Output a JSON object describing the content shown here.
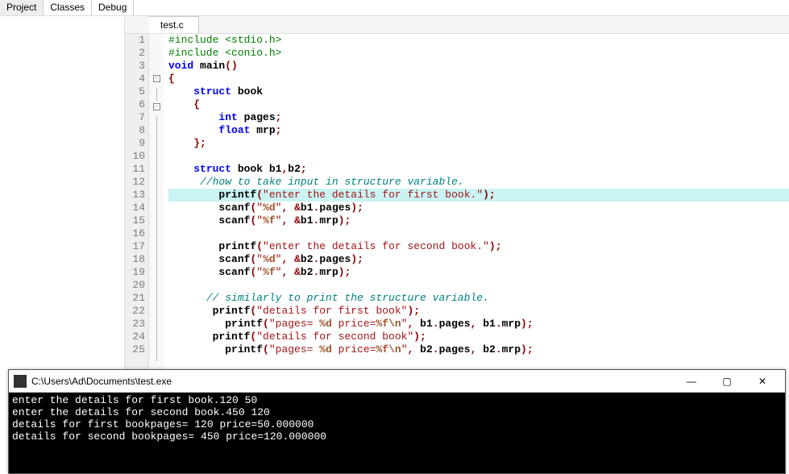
{
  "top_tabs": {
    "project": "Project",
    "classes": "Classes",
    "debug": "Debug"
  },
  "file_tab": "test.c",
  "code_lines": [
    {
      "n": 1,
      "fold": "",
      "hl": false,
      "html": "<span class='pre'>#include &lt;stdio.h&gt;</span>"
    },
    {
      "n": 2,
      "fold": "",
      "hl": false,
      "html": "<span class='pre'>#include &lt;conio.h&gt;</span>"
    },
    {
      "n": 3,
      "fold": "",
      "hl": false,
      "html": "<span class='kw'>void</span> <span class='blk'>main</span><span class='brace'>()</span>"
    },
    {
      "n": 4,
      "fold": "box",
      "hl": false,
      "html": "<span class='brace'>{</span>"
    },
    {
      "n": 5,
      "fold": "line",
      "hl": false,
      "html": "    <span class='kw'>struct</span> <span class='blk'>book</span>"
    },
    {
      "n": 6,
      "fold": "box",
      "hl": false,
      "html": "    <span class='brace'>{</span>"
    },
    {
      "n": 7,
      "fold": "line",
      "hl": false,
      "html": "        <span class='kw'>int</span> <span class='blk'>pages</span><span class='brace'>;</span>"
    },
    {
      "n": 8,
      "fold": "line",
      "hl": false,
      "html": "        <span class='kw'>float</span> <span class='blk'>mrp</span><span class='brace'>;</span>"
    },
    {
      "n": 9,
      "fold": "end",
      "hl": false,
      "html": "    <span class='brace'>};</span>"
    },
    {
      "n": 10,
      "fold": "line",
      "hl": false,
      "html": ""
    },
    {
      "n": 11,
      "fold": "line",
      "hl": false,
      "html": "    <span class='kw'>struct</span> <span class='blk'>book b1</span><span class='brace'>,</span><span class='blk'>b2</span><span class='brace'>;</span>"
    },
    {
      "n": 12,
      "fold": "line",
      "hl": false,
      "html": "     <span class='cmt'>//how to take input in structure variable.</span>"
    },
    {
      "n": 13,
      "fold": "line",
      "hl": true,
      "html": "        <span class='blk'>printf</span><span class='brace'>(</span><span class='str'>\"enter the details for first book.\"</span><span class='brace'>);</span>"
    },
    {
      "n": 14,
      "fold": "line",
      "hl": false,
      "html": "        <span class='blk'>scanf</span><span class='brace'>(</span><span class='str'>\"</span><span class='brown'>%d</span><span class='str'>\"</span><span class='brace'>,</span> <span class='brace'>&amp;</span><span class='blk'>b1</span><span class='brace'>.</span><span class='blk'>pages</span><span class='brace'>);</span>"
    },
    {
      "n": 15,
      "fold": "line",
      "hl": false,
      "html": "        <span class='blk'>scanf</span><span class='brace'>(</span><span class='str'>\"</span><span class='brown'>%f</span><span class='str'>\"</span><span class='brace'>,</span> <span class='brace'>&amp;</span><span class='blk'>b1</span><span class='brace'>.</span><span class='blk'>mrp</span><span class='brace'>);</span>"
    },
    {
      "n": 16,
      "fold": "line",
      "hl": false,
      "html": ""
    },
    {
      "n": 17,
      "fold": "line",
      "hl": false,
      "html": "        <span class='blk'>printf</span><span class='brace'>(</span><span class='str'>\"enter the details for second book.\"</span><span class='brace'>);</span>"
    },
    {
      "n": 18,
      "fold": "line",
      "hl": false,
      "html": "        <span class='blk'>scanf</span><span class='brace'>(</span><span class='str'>\"</span><span class='brown'>%d</span><span class='str'>\"</span><span class='brace'>,</span> <span class='brace'>&amp;</span><span class='blk'>b2</span><span class='brace'>.</span><span class='blk'>pages</span><span class='brace'>);</span>"
    },
    {
      "n": 19,
      "fold": "line",
      "hl": false,
      "html": "        <span class='blk'>scanf</span><span class='brace'>(</span><span class='str'>\"</span><span class='brown'>%f</span><span class='str'>\"</span><span class='brace'>,</span> <span class='brace'>&amp;</span><span class='blk'>b2</span><span class='brace'>.</span><span class='blk'>mrp</span><span class='brace'>);</span>"
    },
    {
      "n": 20,
      "fold": "line",
      "hl": false,
      "html": ""
    },
    {
      "n": 21,
      "fold": "line",
      "hl": false,
      "html": "      <span class='cmt'>// similarly to print the structure variable.</span>"
    },
    {
      "n": 22,
      "fold": "line",
      "hl": false,
      "html": "       <span class='blk'>printf</span><span class='brace'>(</span><span class='str'>\"details for first book\"</span><span class='brace'>);</span>"
    },
    {
      "n": 23,
      "fold": "line",
      "hl": false,
      "html": "         <span class='blk'>printf</span><span class='brace'>(</span><span class='str'>\"pages= </span><span class='brown'>%d</span><span class='str'> price=</span><span class='brown'>%f\\n</span><span class='str'>\"</span><span class='brace'>,</span> <span class='blk'>b1</span><span class='brace'>.</span><span class='blk'>pages</span><span class='brace'>,</span> <span class='blk'>b1</span><span class='brace'>.</span><span class='blk'>mrp</span><span class='brace'>);</span>"
    },
    {
      "n": 24,
      "fold": "line",
      "hl": false,
      "html": "       <span class='blk'>printf</span><span class='brace'>(</span><span class='str'>\"details for second book\"</span><span class='brace'>);</span>"
    },
    {
      "n": 25,
      "fold": "line",
      "hl": false,
      "html": "         <span class='blk'>printf</span><span class='brace'>(</span><span class='str'>\"pages= </span><span class='brown'>%d</span><span class='str'> price=</span><span class='brown'>%f\\n</span><span class='str'>\"</span><span class='brace'>,</span> <span class='blk'>b2</span><span class='brace'>.</span><span class='blk'>pages</span><span class='brace'>,</span> <span class='blk'>b2</span><span class='brace'>.</span><span class='blk'>mrp</span><span class='brace'>);</span>"
    }
  ],
  "console": {
    "title": "C:\\Users\\Ad\\Documents\\test.exe",
    "lines": [
      "enter the details for first book.120 50",
      "enter the details for second book.450 120",
      "details for first bookpages= 120 price=50.000000",
      "details for second bookpages= 450 price=120.000000"
    ]
  },
  "window_btns": {
    "min": "—",
    "max": "▢",
    "close": "✕"
  }
}
